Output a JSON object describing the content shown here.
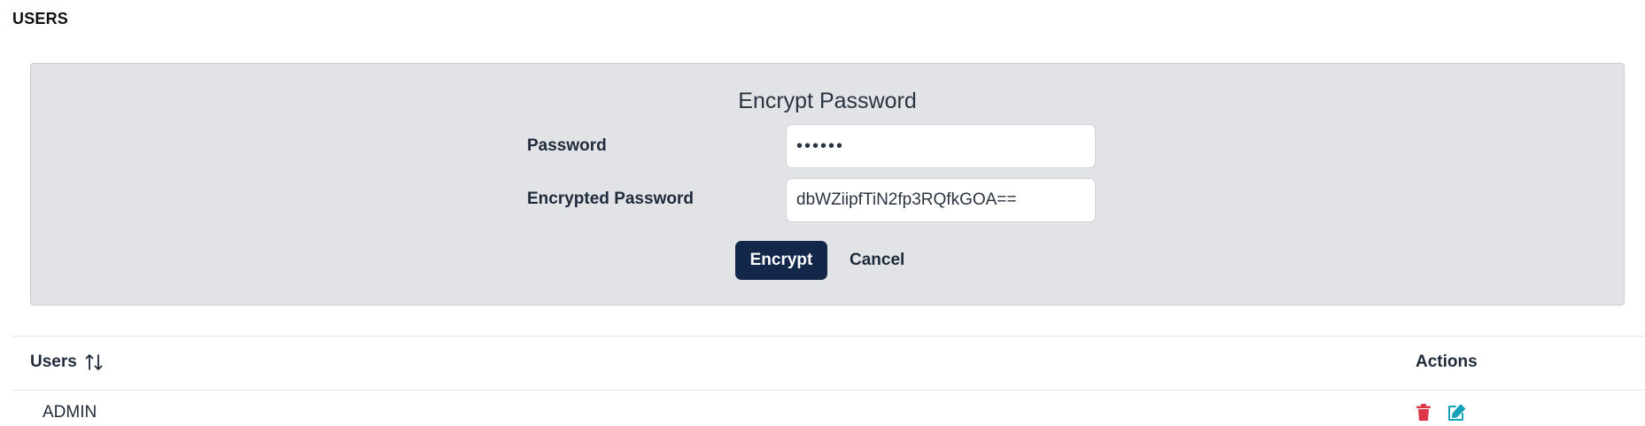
{
  "page": {
    "heading": "USERS"
  },
  "encrypt_form": {
    "title": "Encrypt Password",
    "password_label": "Password",
    "password_value": "••••••",
    "encrypted_label": "Encrypted Password",
    "encrypted_value": "dbWZiipfTiN2fp3RQfkGOA==",
    "encrypt_button": "Encrypt",
    "cancel_button": "Cancel"
  },
  "table": {
    "columns": [
      {
        "label": "Users",
        "sort_icon": "sort-up-down-icon"
      },
      {
        "label": "Actions"
      }
    ],
    "rows": [
      {
        "user": "ADMIN",
        "actions": [
          "delete-icon",
          "edit-icon"
        ]
      }
    ]
  },
  "colors": {
    "primary_button": "#13274a",
    "panel_background": "#e1e3e6",
    "delete_icon": "#dc3545",
    "edit_icon": "#17a2b8"
  }
}
